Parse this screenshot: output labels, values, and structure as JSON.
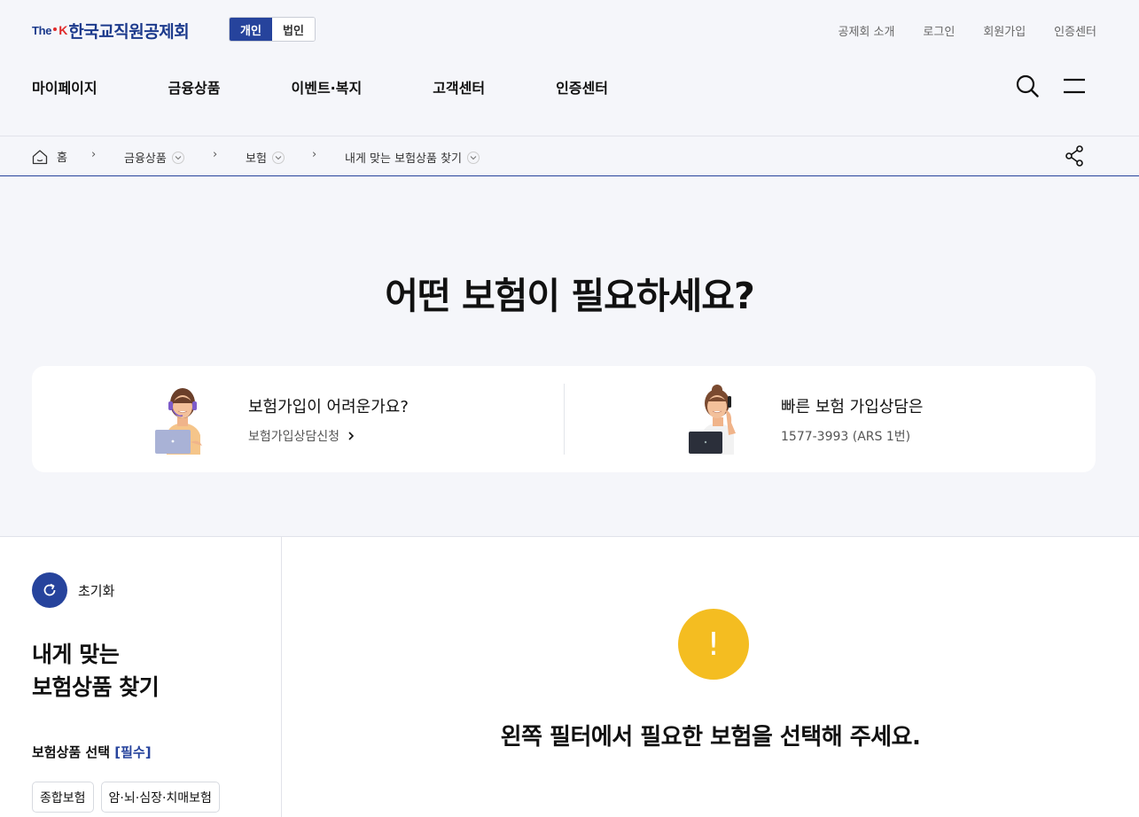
{
  "header": {
    "logo": {
      "prefix": "The",
      "k": "K",
      "name": "한국교직원공제회"
    },
    "member_type": {
      "personal": "개인",
      "corporate": "법인"
    },
    "util_links": [
      "공제회 소개",
      "로그인",
      "회원가입",
      "인증센터"
    ],
    "gnb": [
      "마이페이지",
      "금융상품",
      "이벤트·복지",
      "고객센터",
      "인증센터"
    ]
  },
  "breadcrumb": {
    "home": "홈",
    "items": [
      "금융상품",
      "보험",
      "내게 맞는 보험상품 찾기"
    ]
  },
  "hero": {
    "title": "어떤 보험이 필요하세요?",
    "consult_left": {
      "title": "보험가입이 어려운가요?",
      "link": "보험가입상담신청"
    },
    "consult_right": {
      "title": "빠른 보험 가입상담은",
      "phone": "1577-3993 (ARS 1번)"
    }
  },
  "filter": {
    "reset_label": "초기화",
    "title_line1": "내게 맞는",
    "title_line2": "보험상품 찾기",
    "section_label": "보험상품 선택",
    "section_required": "[필수]",
    "chips": [
      "종합보험",
      "암·뇌·심장·치매보험"
    ]
  },
  "result": {
    "icon_text": "!",
    "message": "왼쪽 필터에서 필요한 보험을 선택해 주세요."
  },
  "colors": {
    "brand": "#26439c",
    "warning": "#f4bd21",
    "background": "#f5f6fa"
  }
}
